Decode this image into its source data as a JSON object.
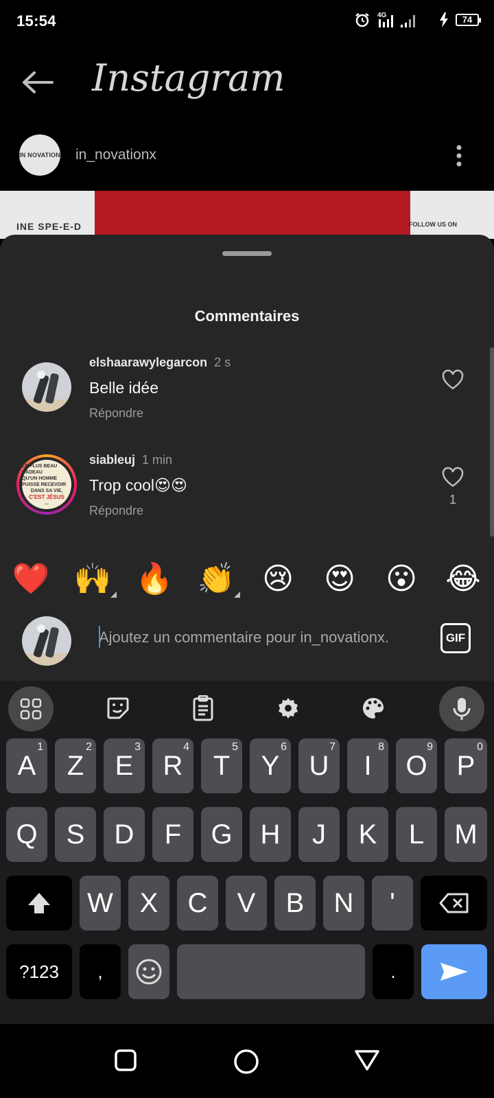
{
  "status_bar": {
    "time": "15:54",
    "network": "4G",
    "battery": "74",
    "icons": [
      "alarm-icon",
      "signal-icon",
      "bolt-icon",
      "battery-icon"
    ]
  },
  "header": {
    "title": "Instagram",
    "back_icon": "arrow-left-icon"
  },
  "post": {
    "username": "in_novationx",
    "avatar_text": "IN NOVATION",
    "image_left_text": "INE SPE-E-D",
    "image_right_text": "FOLLOW US ON"
  },
  "comments_sheet": {
    "title": "Commentaires",
    "comments": [
      {
        "username": "elshaarawylegarcon",
        "time": "2 s",
        "text": "Belle idée",
        "reply_label": "Répondre",
        "likes": ""
      },
      {
        "username": "siableuj",
        "time": "1 min",
        "text": "Trop cool😍😍",
        "reply_label": "Répondre",
        "likes": "1",
        "avatar_lines": [
          "LE PLUS BEAU CADEAU",
          "QU'UN HOMME PUISSE RECEVOIR",
          "DANS SA VIE,",
          "C'EST JÉSUS",
          "..."
        ]
      }
    ],
    "quick_emojis": [
      "❤️",
      "🙌",
      "🔥",
      "👏",
      "😢",
      "😍",
      "😮",
      "😂"
    ],
    "input_placeholder": "Ajoutez un commentaire pour in_novationx.",
    "gif_label": "GIF"
  },
  "keyboard": {
    "toolbar_icons": [
      "apps-grid-icon",
      "sticker-icon",
      "clipboard-icon",
      "settings-gear-icon",
      "palette-icon",
      "microphone-icon"
    ],
    "row1": [
      {
        "k": "A",
        "h": "1"
      },
      {
        "k": "Z",
        "h": "2"
      },
      {
        "k": "E",
        "h": "3"
      },
      {
        "k": "R",
        "h": "4"
      },
      {
        "k": "T",
        "h": "5"
      },
      {
        "k": "Y",
        "h": "6"
      },
      {
        "k": "U",
        "h": "7"
      },
      {
        "k": "I",
        "h": "8"
      },
      {
        "k": "O",
        "h": "9"
      },
      {
        "k": "P",
        "h": "0"
      }
    ],
    "row2": [
      "Q",
      "S",
      "D",
      "F",
      "G",
      "H",
      "J",
      "K",
      "L",
      "M"
    ],
    "row3": [
      "W",
      "X",
      "C",
      "V",
      "B",
      "N",
      "'"
    ],
    "symbols_label": "?123",
    "comma_label": ",",
    "period_label": "."
  },
  "nav_bar": {
    "icons": [
      "recent-apps-icon",
      "home-icon",
      "back-triangle-icon"
    ]
  },
  "colors": {
    "sheet_background": "#262626",
    "keyboard_background": "#1c1c1e",
    "key_background": "#4e4e52",
    "enter_key": "#5b9bf5",
    "cursor": "#3897f0"
  }
}
